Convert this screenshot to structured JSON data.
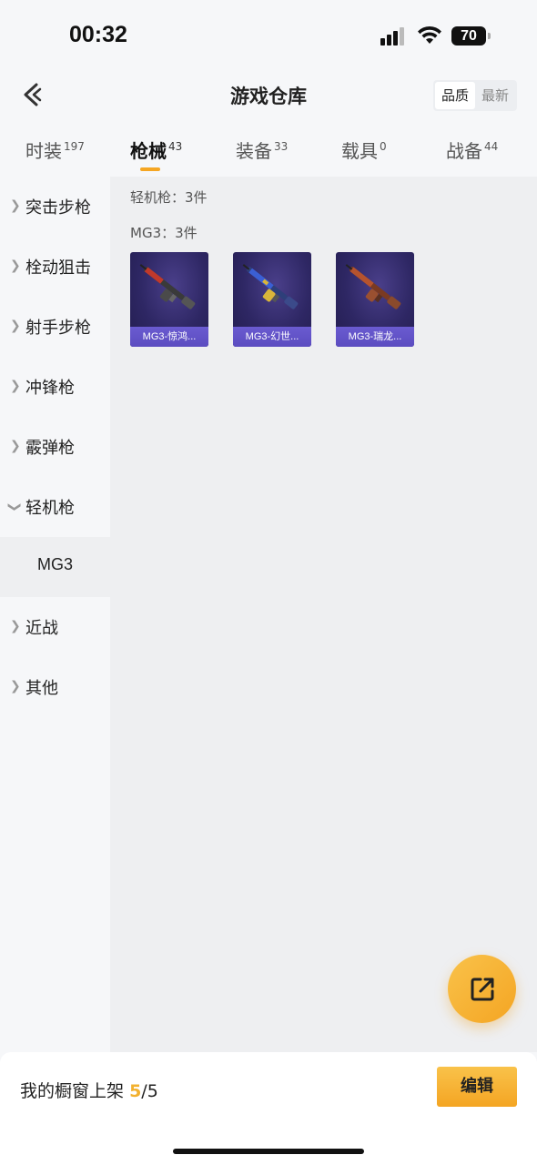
{
  "status_bar": {
    "time": "00:32",
    "battery": "70"
  },
  "header": {
    "title": "游戏仓库",
    "sort_options": [
      "品质",
      "最新"
    ]
  },
  "tabs": [
    {
      "label": "时装",
      "count": "197"
    },
    {
      "label": "枪械",
      "count": "43"
    },
    {
      "label": "装备",
      "count": "33"
    },
    {
      "label": "载具",
      "count": "0"
    },
    {
      "label": "战备",
      "count": "44"
    }
  ],
  "sidebar": {
    "items": [
      {
        "label": "突击步枪"
      },
      {
        "label": "栓动狙击"
      },
      {
        "label": "射手步枪"
      },
      {
        "label": "冲锋枪"
      },
      {
        "label": "霰弹枪"
      },
      {
        "label": "轻机枪"
      }
    ],
    "sub_item": {
      "label": "MG3"
    },
    "items_after": [
      {
        "label": "近战"
      },
      {
        "label": "其他"
      }
    ]
  },
  "content": {
    "category_summary": "轻机枪：3件",
    "subcategory_summary": "MG3：3件",
    "cards": [
      {
        "label": "MG3-惊鸿...",
        "accent": "#c0392b"
      },
      {
        "label": "MG3-幻世...",
        "accent": "#3b5fd4"
      },
      {
        "label": "MG3-瑞龙...",
        "accent": "#b5532e"
      }
    ]
  },
  "fab": {
    "icon": "share-external-icon"
  },
  "bottom_bar": {
    "shelf_label": "我的橱窗上架",
    "shelf_count": "5",
    "shelf_total": "/5",
    "edit_label": "编辑"
  },
  "colors": {
    "accent": "#f5a623",
    "card_bg": "#2e2764",
    "card_label_bg": "#5b4cc0"
  }
}
